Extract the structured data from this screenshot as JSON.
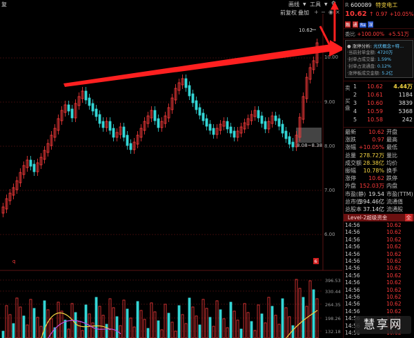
{
  "toolbar": {
    "left_label": "复",
    "menu_drawline": "画线",
    "menu_tools": "工具",
    "btn_fuquan": "前复权",
    "btn_overlay": "叠加"
  },
  "chart": {
    "prices": {
      "p1062": "10.62",
      "p10": "10.00",
      "p9": "9.00",
      "p8": "8.00",
      "p7": "7.00",
      "p6": "6.00"
    },
    "range_label": "8.08~8.38",
    "vol_ticks": [
      "396.53",
      "330.44",
      "264.35",
      "198.26",
      "132.18"
    ],
    "bottom_marker": "q",
    "bottom_badge": "6"
  },
  "stock": {
    "prefix": "R",
    "code": "600089",
    "name": "特变电工",
    "price": "10.62",
    "arrow": "↑",
    "change": "0.97",
    "change_pct": "+10.05%",
    "tags": [
      "融",
      "通",
      "Ra",
      "深"
    ],
    "weibi_label": "委比",
    "weibi_pct": "+100.00%",
    "weibi_val": "+5.51万"
  },
  "limit_up": {
    "title": "涨停分析:",
    "concept": "光伏概念+特...",
    "items": [
      {
        "label": "·当前封单金额:",
        "value": "4720万"
      },
      {
        "label": "·封单占成交量:",
        "value": "1.59%"
      },
      {
        "label": "·封单占流通盘:",
        "value": "0.12%"
      },
      {
        "label": "·涨停板成交金额:",
        "value": "5.2亿"
      }
    ]
  },
  "order_book": {
    "sell_label": "卖",
    "buy_label": "买盘",
    "rows": [
      {
        "n": "1",
        "price": "10.62",
        "vol": "4.44万"
      },
      {
        "n": "2",
        "price": "10.61",
        "vol": "1184"
      },
      {
        "n": "3",
        "price": "10.60",
        "vol": "3839"
      },
      {
        "n": "4",
        "price": "10.59",
        "vol": "5368"
      },
      {
        "n": "5",
        "price": "10.58",
        "vol": "242"
      }
    ]
  },
  "quote": [
    {
      "l1": "最新",
      "v1": "10.62",
      "l2": "开盘",
      "c": "red"
    },
    {
      "l1": "涨跌",
      "v1": "0.97",
      "l2": "最高",
      "c": "red"
    },
    {
      "l1": "涨幅",
      "v1": "+10.05%",
      "l2": "最低",
      "c": "red"
    },
    {
      "l1": "总量",
      "v1": "278.72万",
      "l2": "量比",
      "c": "yellow"
    },
    {
      "l1": "成交额",
      "v1": "28.38亿",
      "l2": "均价",
      "c": "yellow"
    },
    {
      "l1": "振幅",
      "v1": "10.78%",
      "l2": "换手",
      "c": "yellow"
    },
    {
      "l1": "涨停",
      "v1": "10.62",
      "l2": "跌停",
      "c": "red"
    },
    {
      "l1": "外盘",
      "v1": "152.03万",
      "l2": "内盘",
      "c": "red"
    },
    {
      "l1": "市盈(静)",
      "v1": "19.54",
      "l2": "市盈(TTM)",
      "c": "white"
    },
    {
      "l1": "总市值",
      "v1": "394.46亿",
      "l2": "流通值",
      "c": "white"
    },
    {
      "l1": "总股本",
      "v1": "37.14亿",
      "l2": "流通股",
      "c": "white"
    }
  ],
  "level2": {
    "label": "Level-2超级资金",
    "badge": "全"
  },
  "ticks": {
    "time": "14:56",
    "price": "10.62",
    "count": 16
  },
  "watermark": "慧享网"
}
